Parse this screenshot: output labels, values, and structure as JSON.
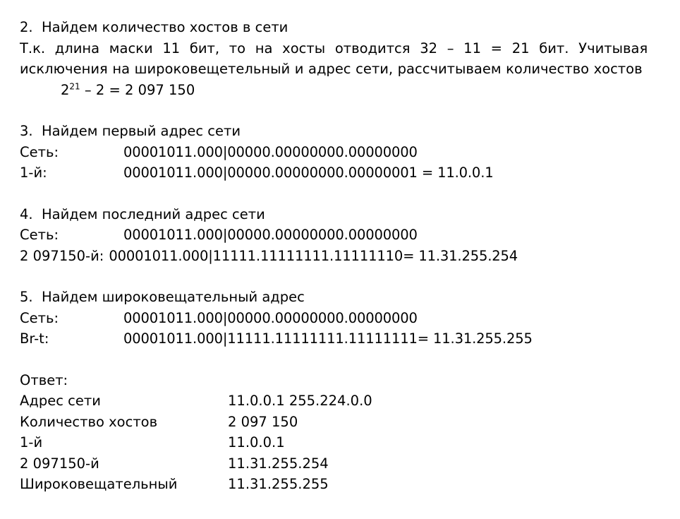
{
  "document": {
    "background_color": "#ffffff",
    "text_color": "#000000",
    "language": "ru"
  },
  "sections": {
    "hosts_count": {
      "heading": "2.  Найдем количество хостов в сети",
      "paragraph_line1": "Т.к. длина маски 11 бит, то на хосты отводится 32 – 11 = 21 бит. Учитывая",
      "paragraph_line2": "исключения на широковещетельный и адрес сети, рассчитываем количество хостов",
      "formula_base": "2",
      "formula_exponent": "21",
      "formula_rest": " – 2 = 2 097 150"
    },
    "first_address": {
      "heading": "3.  Найдем первый адрес сети",
      "rows": [
        {
          "label": "Сеть:",
          "bits": "00001011.000|00000.00000000.00000000",
          "equals": ""
        },
        {
          "label": "1-й:",
          "bits": "00001011.000|00000.00000000.00000001",
          "equals": " = 11.0.0.1"
        }
      ]
    },
    "last_address": {
      "heading": "4.  Найдем последний адрес сети",
      "rows": [
        {
          "label": "Сеть:",
          "bits": "00001011.000|00000.00000000.00000000",
          "equals": ""
        },
        {
          "label": "2 097150-й:",
          "bits": "00001011.000|11111.11111111.11111110",
          "equals": "= 11.31.255.254"
        }
      ]
    },
    "broadcast_address": {
      "heading": "5.  Найдем широковещательный адрес",
      "rows": [
        {
          "label": "Сеть:",
          "bits": "00001011.000|00000.00000000.00000000",
          "equals": ""
        },
        {
          "label": "Br-t:",
          "bits": "00001011.000|11111.11111111.11111111",
          "equals": "= 11.31.255.255"
        }
      ]
    },
    "answer": {
      "heading": "Ответ:",
      "rows": [
        {
          "key": "Адрес сети",
          "value": "11.0.0.1 255.224.0.0"
        },
        {
          "key": "Количество хостов",
          "value": "2 097 150"
        },
        {
          "key": "1-й",
          "value": "11.0.0.1"
        },
        {
          "key": "2 097150-й",
          "value": "11.31.255.254"
        },
        {
          "key": "Широковещательный",
          "value": "11.31.255.255"
        }
      ]
    }
  }
}
